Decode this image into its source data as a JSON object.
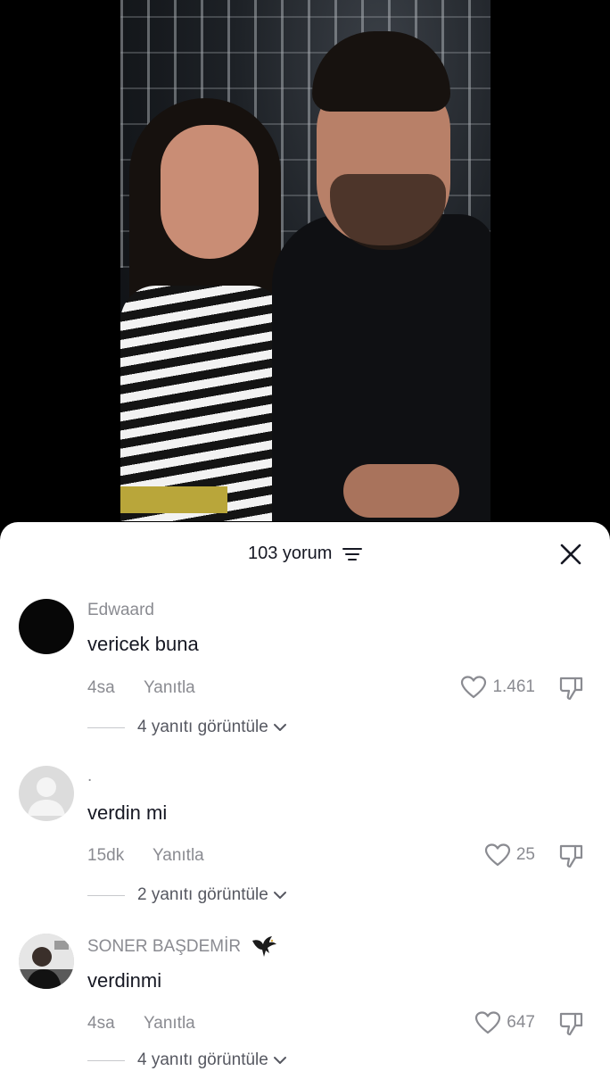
{
  "comments_sheet": {
    "count_label": "103 yorum",
    "comments": [
      {
        "username": "Edwaard",
        "text": "vericek buna",
        "time": "4sa",
        "reply_label": "Yanıtla",
        "likes": "1.461",
        "view_replies": "4 yanıtı görüntüle"
      },
      {
        "username": ".",
        "text": "verdin mi",
        "time": "15dk",
        "reply_label": "Yanıtla",
        "likes": "25",
        "view_replies": "2 yanıtı görüntüle"
      },
      {
        "username": "SONER BAŞDEMİR",
        "text": "verdinmi",
        "time": "4sa",
        "reply_label": "Yanıtla",
        "likes": "647",
        "view_replies": "4 yanıtı görüntüle"
      }
    ]
  },
  "icons": {
    "filter": "filter-icon",
    "close": "close-icon",
    "like": "heart-icon",
    "dislike": "thumbs-down-icon",
    "chevron": "chevron-down-icon",
    "username_badge": "eagle-icon"
  },
  "colors": {
    "text_primary": "#161823",
    "text_secondary": "#8a8b91",
    "sheet_bg": "#ffffff",
    "backdrop": "#000000"
  }
}
